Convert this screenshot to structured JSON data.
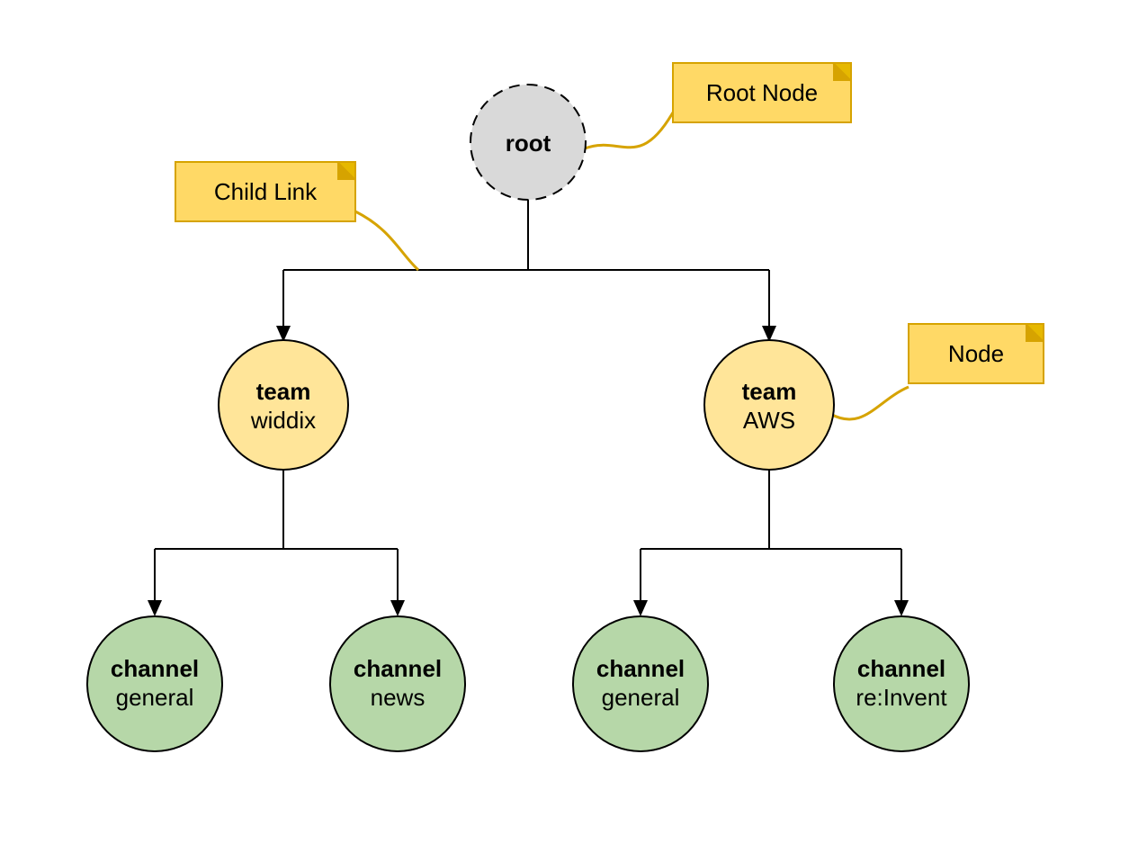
{
  "root": {
    "label": "root"
  },
  "teams": [
    {
      "type": "team",
      "name": "widdix"
    },
    {
      "type": "team",
      "name": "AWS"
    }
  ],
  "channels": [
    {
      "type": "channel",
      "name": "general"
    },
    {
      "type": "channel",
      "name": "news"
    },
    {
      "type": "channel",
      "name": "general"
    },
    {
      "type": "channel",
      "name": "re:Invent"
    }
  ],
  "annotations": {
    "root_note": "Root Node",
    "child_link_note": "Child Link",
    "node_note": "Node"
  },
  "colors": {
    "root": "#d9d9d9",
    "team": "#ffe599",
    "channel": "#b6d7a8",
    "note": "#ffd966",
    "note_border": "#d6a300"
  }
}
